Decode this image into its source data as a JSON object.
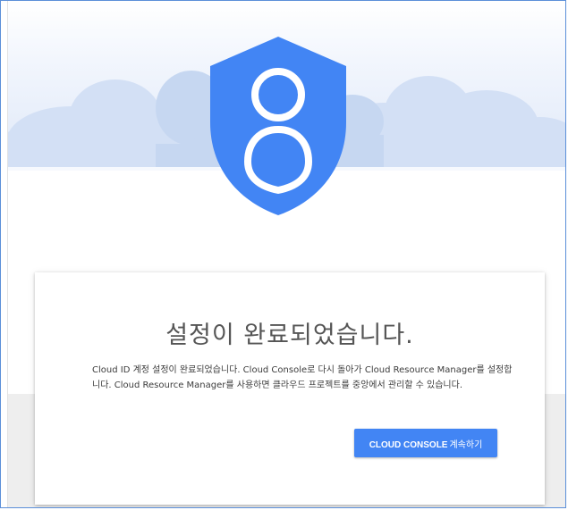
{
  "card": {
    "title": "설정이 완료되었습니다.",
    "message": "Cloud ID 계정 설정이 완료되었습니다. Cloud Console로 다시 돌아가 Cloud Resource Manager를 설정합니다. Cloud Resource Manager를 사용하면 클라우드 프로젝트를 중앙에서 관리할 수 있습니다.",
    "button_strong": "CLOUD CONSOLE",
    "button_rest": "계속하기"
  },
  "colors": {
    "accent": "#4285f4",
    "shield": "#4285f4",
    "sky": "#e3ecfb",
    "cloud": "#d2e0f5",
    "frame_border": "#5b8fd9"
  },
  "icons": {
    "hero": "shield-user-icon"
  }
}
